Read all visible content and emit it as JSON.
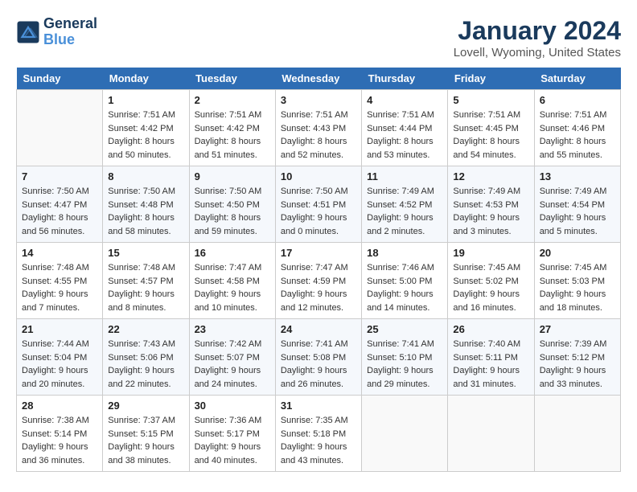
{
  "logo": {
    "line1": "General",
    "line2": "Blue"
  },
  "title": "January 2024",
  "subtitle": "Lovell, Wyoming, United States",
  "days_header": [
    "Sunday",
    "Monday",
    "Tuesday",
    "Wednesday",
    "Thursday",
    "Friday",
    "Saturday"
  ],
  "weeks": [
    [
      {
        "number": "",
        "sunrise": "",
        "sunset": "",
        "daylight": ""
      },
      {
        "number": "1",
        "sunrise": "Sunrise: 7:51 AM",
        "sunset": "Sunset: 4:42 PM",
        "daylight": "Daylight: 8 hours and 50 minutes."
      },
      {
        "number": "2",
        "sunrise": "Sunrise: 7:51 AM",
        "sunset": "Sunset: 4:42 PM",
        "daylight": "Daylight: 8 hours and 51 minutes."
      },
      {
        "number": "3",
        "sunrise": "Sunrise: 7:51 AM",
        "sunset": "Sunset: 4:43 PM",
        "daylight": "Daylight: 8 hours and 52 minutes."
      },
      {
        "number": "4",
        "sunrise": "Sunrise: 7:51 AM",
        "sunset": "Sunset: 4:44 PM",
        "daylight": "Daylight: 8 hours and 53 minutes."
      },
      {
        "number": "5",
        "sunrise": "Sunrise: 7:51 AM",
        "sunset": "Sunset: 4:45 PM",
        "daylight": "Daylight: 8 hours and 54 minutes."
      },
      {
        "number": "6",
        "sunrise": "Sunrise: 7:51 AM",
        "sunset": "Sunset: 4:46 PM",
        "daylight": "Daylight: 8 hours and 55 minutes."
      }
    ],
    [
      {
        "number": "7",
        "sunrise": "Sunrise: 7:50 AM",
        "sunset": "Sunset: 4:47 PM",
        "daylight": "Daylight: 8 hours and 56 minutes."
      },
      {
        "number": "8",
        "sunrise": "Sunrise: 7:50 AM",
        "sunset": "Sunset: 4:48 PM",
        "daylight": "Daylight: 8 hours and 58 minutes."
      },
      {
        "number": "9",
        "sunrise": "Sunrise: 7:50 AM",
        "sunset": "Sunset: 4:50 PM",
        "daylight": "Daylight: 8 hours and 59 minutes."
      },
      {
        "number": "10",
        "sunrise": "Sunrise: 7:50 AM",
        "sunset": "Sunset: 4:51 PM",
        "daylight": "Daylight: 9 hours and 0 minutes."
      },
      {
        "number": "11",
        "sunrise": "Sunrise: 7:49 AM",
        "sunset": "Sunset: 4:52 PM",
        "daylight": "Daylight: 9 hours and 2 minutes."
      },
      {
        "number": "12",
        "sunrise": "Sunrise: 7:49 AM",
        "sunset": "Sunset: 4:53 PM",
        "daylight": "Daylight: 9 hours and 3 minutes."
      },
      {
        "number": "13",
        "sunrise": "Sunrise: 7:49 AM",
        "sunset": "Sunset: 4:54 PM",
        "daylight": "Daylight: 9 hours and 5 minutes."
      }
    ],
    [
      {
        "number": "14",
        "sunrise": "Sunrise: 7:48 AM",
        "sunset": "Sunset: 4:55 PM",
        "daylight": "Daylight: 9 hours and 7 minutes."
      },
      {
        "number": "15",
        "sunrise": "Sunrise: 7:48 AM",
        "sunset": "Sunset: 4:57 PM",
        "daylight": "Daylight: 9 hours and 8 minutes."
      },
      {
        "number": "16",
        "sunrise": "Sunrise: 7:47 AM",
        "sunset": "Sunset: 4:58 PM",
        "daylight": "Daylight: 9 hours and 10 minutes."
      },
      {
        "number": "17",
        "sunrise": "Sunrise: 7:47 AM",
        "sunset": "Sunset: 4:59 PM",
        "daylight": "Daylight: 9 hours and 12 minutes."
      },
      {
        "number": "18",
        "sunrise": "Sunrise: 7:46 AM",
        "sunset": "Sunset: 5:00 PM",
        "daylight": "Daylight: 9 hours and 14 minutes."
      },
      {
        "number": "19",
        "sunrise": "Sunrise: 7:45 AM",
        "sunset": "Sunset: 5:02 PM",
        "daylight": "Daylight: 9 hours and 16 minutes."
      },
      {
        "number": "20",
        "sunrise": "Sunrise: 7:45 AM",
        "sunset": "Sunset: 5:03 PM",
        "daylight": "Daylight: 9 hours and 18 minutes."
      }
    ],
    [
      {
        "number": "21",
        "sunrise": "Sunrise: 7:44 AM",
        "sunset": "Sunset: 5:04 PM",
        "daylight": "Daylight: 9 hours and 20 minutes."
      },
      {
        "number": "22",
        "sunrise": "Sunrise: 7:43 AM",
        "sunset": "Sunset: 5:06 PM",
        "daylight": "Daylight: 9 hours and 22 minutes."
      },
      {
        "number": "23",
        "sunrise": "Sunrise: 7:42 AM",
        "sunset": "Sunset: 5:07 PM",
        "daylight": "Daylight: 9 hours and 24 minutes."
      },
      {
        "number": "24",
        "sunrise": "Sunrise: 7:41 AM",
        "sunset": "Sunset: 5:08 PM",
        "daylight": "Daylight: 9 hours and 26 minutes."
      },
      {
        "number": "25",
        "sunrise": "Sunrise: 7:41 AM",
        "sunset": "Sunset: 5:10 PM",
        "daylight": "Daylight: 9 hours and 29 minutes."
      },
      {
        "number": "26",
        "sunrise": "Sunrise: 7:40 AM",
        "sunset": "Sunset: 5:11 PM",
        "daylight": "Daylight: 9 hours and 31 minutes."
      },
      {
        "number": "27",
        "sunrise": "Sunrise: 7:39 AM",
        "sunset": "Sunset: 5:12 PM",
        "daylight": "Daylight: 9 hours and 33 minutes."
      }
    ],
    [
      {
        "number": "28",
        "sunrise": "Sunrise: 7:38 AM",
        "sunset": "Sunset: 5:14 PM",
        "daylight": "Daylight: 9 hours and 36 minutes."
      },
      {
        "number": "29",
        "sunrise": "Sunrise: 7:37 AM",
        "sunset": "Sunset: 5:15 PM",
        "daylight": "Daylight: 9 hours and 38 minutes."
      },
      {
        "number": "30",
        "sunrise": "Sunrise: 7:36 AM",
        "sunset": "Sunset: 5:17 PM",
        "daylight": "Daylight: 9 hours and 40 minutes."
      },
      {
        "number": "31",
        "sunrise": "Sunrise: 7:35 AM",
        "sunset": "Sunset: 5:18 PM",
        "daylight": "Daylight: 9 hours and 43 minutes."
      },
      {
        "number": "",
        "sunrise": "",
        "sunset": "",
        "daylight": ""
      },
      {
        "number": "",
        "sunrise": "",
        "sunset": "",
        "daylight": ""
      },
      {
        "number": "",
        "sunrise": "",
        "sunset": "",
        "daylight": ""
      }
    ]
  ]
}
